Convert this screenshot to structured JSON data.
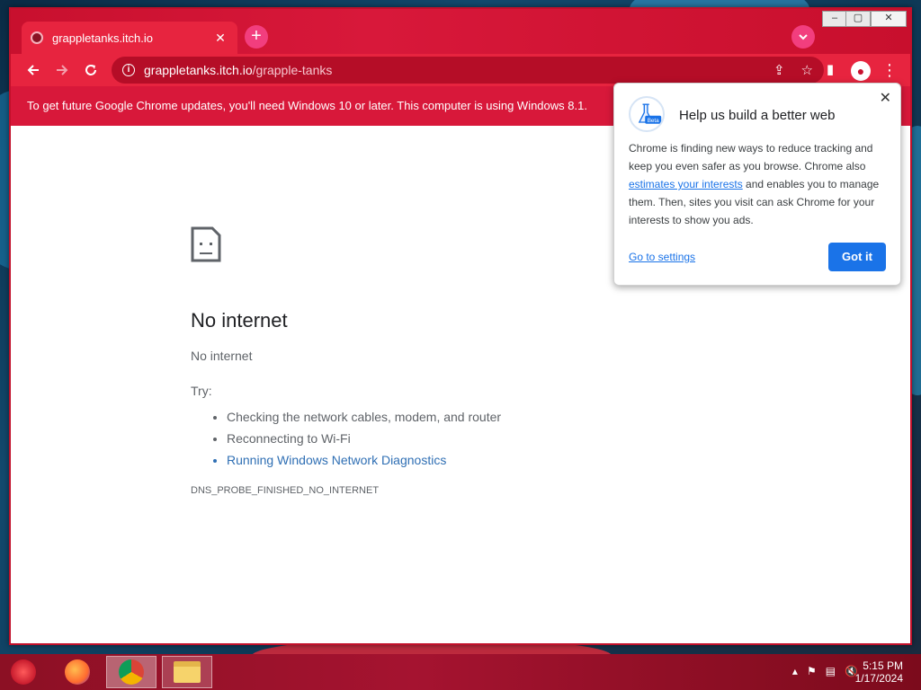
{
  "window": {
    "tab_title": "grappletanks.itch.io",
    "new_tab_symbol": "+",
    "url_host": "grappletanks.itch.io",
    "url_path": "/grapple-tanks",
    "controls": {
      "minimize": "–",
      "maximize": "▢",
      "close": "✕"
    }
  },
  "infobar": {
    "message": "To get future Google Chrome updates, you'll need Windows 10 or later. This computer is using Windows 8.1."
  },
  "error_page": {
    "title": "No internet",
    "subtitle": "No internet",
    "try_label": "Try:",
    "suggestions": [
      "Checking the network cables, modem, and router",
      "Reconnecting to Wi-Fi",
      "Running Windows Network Diagnostics"
    ],
    "error_code": "DNS_PROBE_FINISHED_NO_INTERNET"
  },
  "bubble": {
    "badge": "Beta",
    "title": "Help us build a better web",
    "body_before": "Chrome is finding new ways to reduce tracking and keep you even safer as you browse. Chrome also ",
    "body_link": "estimates your interests",
    "body_after": " and enables you to manage them. Then, sites you visit can ask Chrome for your interests to show you ads.",
    "settings_link": "Go to settings",
    "got_it": "Got it"
  },
  "taskbar": {
    "time": "5:15 PM",
    "date": "1/17/2024"
  },
  "colors": {
    "chrome_red": "#c8102e",
    "link_blue": "#1a73e8"
  }
}
